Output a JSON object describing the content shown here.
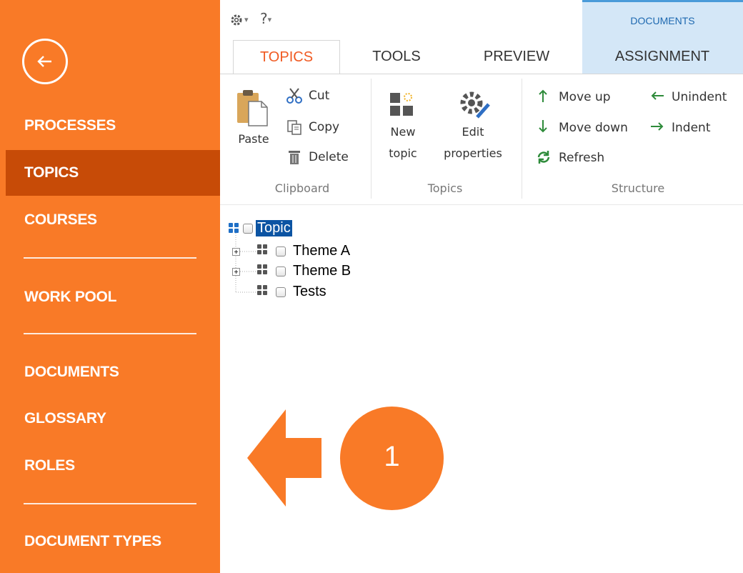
{
  "sidebar": {
    "items": [
      {
        "label": "PROCESSES",
        "active": false
      },
      {
        "label": "TOPICS",
        "active": true
      },
      {
        "label": "COURSES",
        "active": false
      },
      {
        "label": "WORK POOL",
        "active": false
      },
      {
        "label": "DOCUMENTS",
        "active": false
      },
      {
        "label": "GLOSSARY",
        "active": false
      },
      {
        "label": "ROLES",
        "active": false
      },
      {
        "label": "DOCUMENT TYPES",
        "active": false
      }
    ]
  },
  "quick_access": {
    "settings_icon": "gear-icon",
    "help": "?"
  },
  "ribbon": {
    "context_group": "DOCUMENTS",
    "tabs": [
      "TOPICS",
      "TOOLS",
      "PREVIEW",
      "ASSIGNMENT"
    ],
    "active_tab": "TOPICS",
    "groups": {
      "clipboard": {
        "label": "Clipboard",
        "paste": "Paste",
        "cut": "Cut",
        "copy": "Copy",
        "delete": "Delete"
      },
      "topics": {
        "label": "Topics",
        "new_topic_1": "New",
        "new_topic_2": "topic",
        "edit_properties_1": "Edit",
        "edit_properties_2": "properties"
      },
      "structure": {
        "label": "Structure",
        "move_up": "Move up",
        "move_down": "Move down",
        "refresh": "Refresh",
        "unindent": "Unindent",
        "indent": "Indent"
      }
    }
  },
  "tree": {
    "root": "Topic",
    "children": [
      "Theme A",
      "Theme B",
      "Tests"
    ]
  },
  "callout": {
    "number": "1"
  },
  "colors": {
    "sidebar": "#f97a27",
    "sidebar_active": "#c74b07",
    "tab_active": "#f05a22",
    "context_group": "#d4e7f7",
    "selection": "#0c54a3"
  }
}
